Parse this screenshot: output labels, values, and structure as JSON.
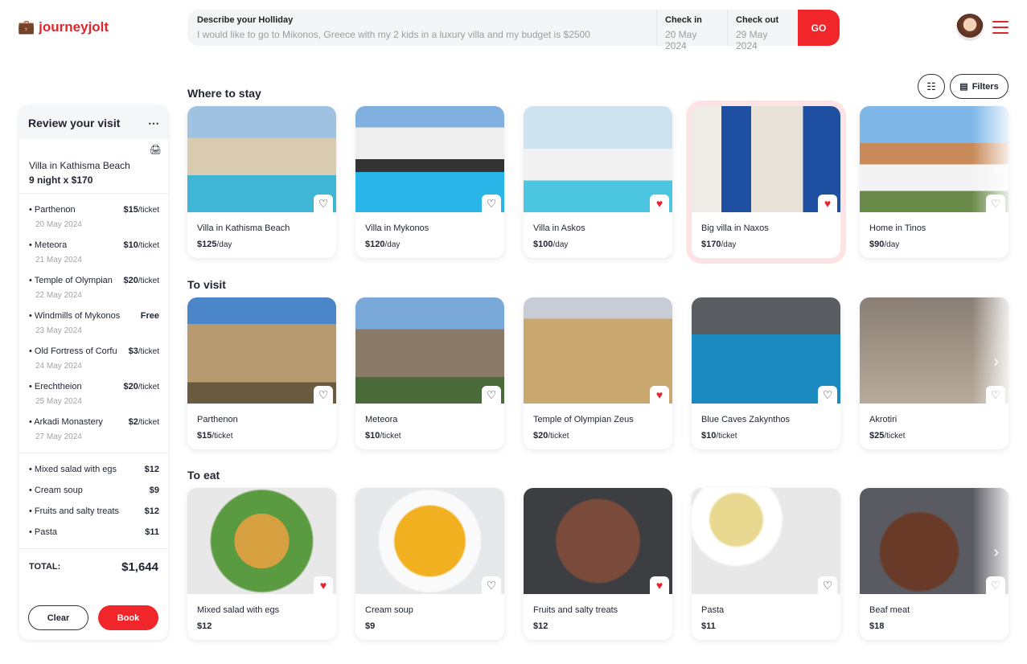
{
  "header": {
    "logo": "journeyjolt",
    "search_label": "Describe your Holliday",
    "search_value": "I would like to go to Mikonos, Greece with my 2 kids in a luxury villa and my budget is $2500",
    "checkin_label": "Check in",
    "checkin_value": "20 May 2024",
    "checkout_label": "Check out",
    "checkout_value": "29 May 2024",
    "go": "GO"
  },
  "toolbar": {
    "filters": "Filters"
  },
  "review": {
    "title": "Review your visit",
    "villa": "Villa in Kathisma Beach",
    "villa_price": "9 night x $170",
    "visits": [
      {
        "name": "Parthenon",
        "price": "$15",
        "unit": "/ticket",
        "date": "20 May 2024"
      },
      {
        "name": "Meteora",
        "price": "$10",
        "unit": "/ticket",
        "date": "21 May 2024"
      },
      {
        "name": "Temple of Olympian",
        "price": "$20",
        "unit": "/ticket",
        "date": "22 May 2024"
      },
      {
        "name": "Windmills of Mykonos",
        "price": "Free",
        "unit": "",
        "date": "23 May 2024"
      },
      {
        "name": "Old Fortress of Corfu",
        "price": "$3",
        "unit": "/ticket",
        "date": "24 May 2024"
      },
      {
        "name": "Erechtheion",
        "price": "$20",
        "unit": "/ticket",
        "date": "25 May 2024"
      },
      {
        "name": "Arkadi Monastery",
        "price": "$2",
        "unit": "/ticket",
        "date": "27 May 2024"
      }
    ],
    "food": [
      {
        "name": "Mixed salad with egs",
        "price": "$12"
      },
      {
        "name": "Cream soup",
        "price": "$9"
      },
      {
        "name": "Fruits and salty treats",
        "price": "$12"
      },
      {
        "name": "Pasta",
        "price": "$11"
      }
    ],
    "total_label": "TOTAL:",
    "total": "$1,644",
    "clear": "Clear",
    "book": "Book"
  },
  "sections": [
    {
      "title": "Where to stay",
      "items": [
        {
          "name": "Villa in Kathisma Beach",
          "price": "$125",
          "unit": "/day",
          "fav": false,
          "bg": "linear-gradient(#9fc2e0 0 30%,#d9cbb0 30% 65%,#3fb6d6 65%)"
        },
        {
          "name": "Villa in Mykonos",
          "price": "$120",
          "unit": "/day",
          "fav": false,
          "bg": "linear-gradient(#7fb0e0 0 20%,#eeeeee 20% 50%,#333 50% 62%,#29b5e8 62%)"
        },
        {
          "name": "Villa in Askos",
          "price": "$100",
          "unit": "/day",
          "fav": true,
          "bg": "linear-gradient(#cfe2f0 0 40%,#f1f1f1 40% 70%,#4cc5e0 70%)"
        },
        {
          "name": "Big villa in Naxos",
          "price": "$170",
          "unit": "/day",
          "fav": true,
          "highlight": true,
          "bg": "linear-gradient(90deg,#f0ede8 0 20%,#1f4fa0 20% 40%,#e8e2d8 40% 75%,#1f4fa0 75%)"
        },
        {
          "name": "Home in Tinos",
          "price": "$90",
          "unit": "/day",
          "fav": false,
          "bg": "linear-gradient(#7fb8e8 0 35%,#c98a5a 35% 55%,#f3f3f3 55% 80%,#6a8a4a 80%)"
        }
      ]
    },
    {
      "title": "To visit",
      "items": [
        {
          "name": "Parthenon",
          "price": "$15",
          "unit": "/ticket",
          "fav": false,
          "bg": "linear-gradient(#4a86c8 0 25%,#b89a70 25% 80%,#6a5a40 80%)"
        },
        {
          "name": "Meteora",
          "price": "$10",
          "unit": "/ticket",
          "fav": false,
          "bg": "linear-gradient(#7aa8d8 0 30%,#8a7a68 30% 75%,#4a6a3a 75%)"
        },
        {
          "name": "Temple of Olympian Zeus",
          "price": "$20",
          "unit": "/ticket",
          "fav": true,
          "bg": "linear-gradient(#c8cdd5 0 20%,#c9a870 20%)"
        },
        {
          "name": "Blue Caves Zakynthos",
          "price": "$10",
          "unit": "/ticket",
          "fav": false,
          "bg": "linear-gradient(#5a5e62 0 35%,#1a8ac0 35%)"
        },
        {
          "name": "Akrotiri",
          "price": "$25",
          "unit": "/ticket",
          "fav": false,
          "bg": "linear-gradient(#8a7f74,#b7aa9a)"
        }
      ]
    },
    {
      "title": "To eat",
      "items": [
        {
          "name": "Mixed salad with egs",
          "price": "$12",
          "unit": "",
          "fav": true,
          "bg": "radial-gradient(circle,#d6a040 0 30%,#5a9a40 30% 55%,#e8e8e8 57%)"
        },
        {
          "name": "Cream soup",
          "price": "$9",
          "unit": "",
          "fav": false,
          "bg": "radial-gradient(circle,#f0b020 0 38%,#fafafa 40% 55%,#e6e8ea 57%)"
        },
        {
          "name": "Fruits and salty treats",
          "price": "$12",
          "unit": "",
          "fav": true,
          "bg": "radial-gradient(circle,#7a4a3a 0 45%,#3c3e42 47%)"
        },
        {
          "name": "Pasta",
          "price": "$11",
          "unit": "",
          "fav": false,
          "bg": "radial-gradient(circle at 30% 30%,#e8d890 0 20%,#fff 22% 35%,#e8e8e8 37%)"
        },
        {
          "name": "Beaf meat",
          "price": "$18",
          "unit": "",
          "fav": false,
          "bg": "radial-gradient(circle at 40% 60%,#6a3a28 0 35%,#5a5a62 37%)"
        }
      ]
    }
  ]
}
